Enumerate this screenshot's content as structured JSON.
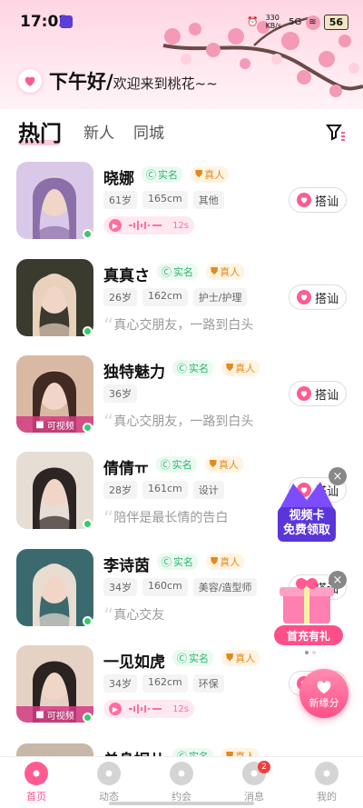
{
  "status_bar": {
    "time": "17:02",
    "network_speed": "330\nKB/s",
    "signal": "5G",
    "battery": "56"
  },
  "greeting": {
    "main": "下午好/",
    "sub": "欢迎来到桃花~~"
  },
  "tabs": [
    {
      "label": "热门",
      "active": true
    },
    {
      "label": "新人"
    },
    {
      "label": "同城"
    }
  ],
  "badges": {
    "real_name": "实名",
    "real_person": "真人"
  },
  "chat_label": "搭讪",
  "video_label": "可视频",
  "users": [
    {
      "name": "晓娜",
      "chips": [
        "61岁",
        "165cm",
        "其他"
      ],
      "voice": "12s",
      "video": false
    },
    {
      "name": "真真さ",
      "chips": [
        "26岁",
        "162cm",
        "护士/护理"
      ],
      "bio": "真心交朋友，一路到白头",
      "video": false
    },
    {
      "name": "独特魅力",
      "chips": [
        "36岁"
      ],
      "bio": "真心交朋友，一路到白头",
      "video": true
    },
    {
      "name": "倩倩ㅠ",
      "chips": [
        "28岁",
        "161cm",
        "设计"
      ],
      "bio": "陪伴是最长情的告白",
      "video": false
    },
    {
      "name": "李诗茵",
      "chips": [
        "34岁",
        "160cm",
        "美容/造型师"
      ],
      "bio": "真心交友",
      "video": false
    },
    {
      "name": "一见如虎",
      "chips": [
        "34岁",
        "162cm",
        "环保"
      ],
      "voice": "12s",
      "video": true
    },
    {
      "name": "单身妮儿",
      "chips": [],
      "video": false
    }
  ],
  "promos": {
    "video_card": "视频卡\n免费领取",
    "first_recharge": "首充有礼",
    "close": "×"
  },
  "new_fate": "新缘分",
  "bottom_nav": [
    {
      "label": "首页",
      "active": true
    },
    {
      "label": "动态"
    },
    {
      "label": "约会"
    },
    {
      "label": "消息",
      "badge": "2"
    },
    {
      "label": "我的"
    }
  ],
  "colors": {
    "accent": "#ff5b92",
    "real": "#2fb36c",
    "person": "#e38a1e"
  }
}
